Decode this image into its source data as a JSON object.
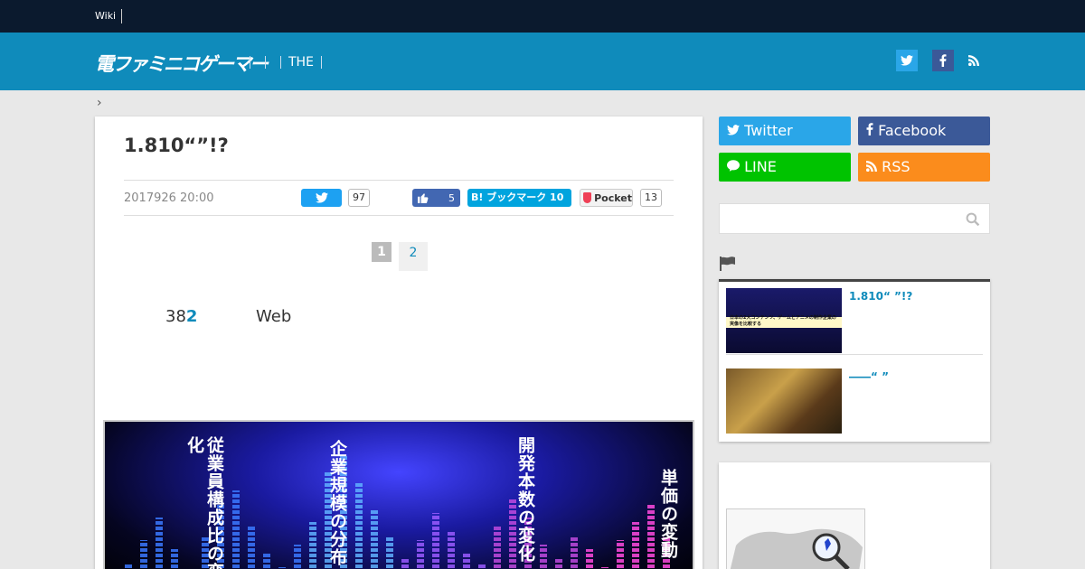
{
  "topbar": {
    "wiki": "Wiki"
  },
  "header": {
    "logo": "電ファミニコゲーマー",
    "nav": [
      "",
      "",
      "THE"
    ]
  },
  "breadcrumb": {
    "arrow": "›"
  },
  "article": {
    "title": "1.810“”!?",
    "date": "2017926 20:00",
    "share": {
      "twitter_count": "97",
      "facebook_count": "5",
      "hatena_label": "B! ブックマーク 10",
      "pocket_label": "Pocket",
      "pocket_count": "13"
    },
    "pager": [
      "1",
      "2"
    ],
    "lead": {
      "prefix": "38",
      "highlight": "2",
      "suffix": "Web"
    },
    "hero": {
      "texts": [
        "従業員構成比の変化",
        "企業規模の分布",
        "開発本数の変化",
        "単価の変動"
      ]
    }
  },
  "sidebar": {
    "buttons": {
      "twitter": "Twitter",
      "facebook": "Facebook",
      "line": "LINE",
      "rss": "RSS"
    },
    "search_placeholder": "",
    "widget": {
      "items": [
        {
          "title": "1.810“ ”!?",
          "thumb_text": "日本の2大コンテンツ、ゲームとアニメの制作企業の実像を比較する"
        },
        {
          "title": "――“ ”"
        }
      ]
    }
  },
  "colors": {
    "brand": "#0f8bbb",
    "topbar": "#0b1a2e",
    "twitter": "#2aa6e8",
    "facebook": "#3b5998",
    "line": "#00c300",
    "rss": "#fb8c1c"
  }
}
